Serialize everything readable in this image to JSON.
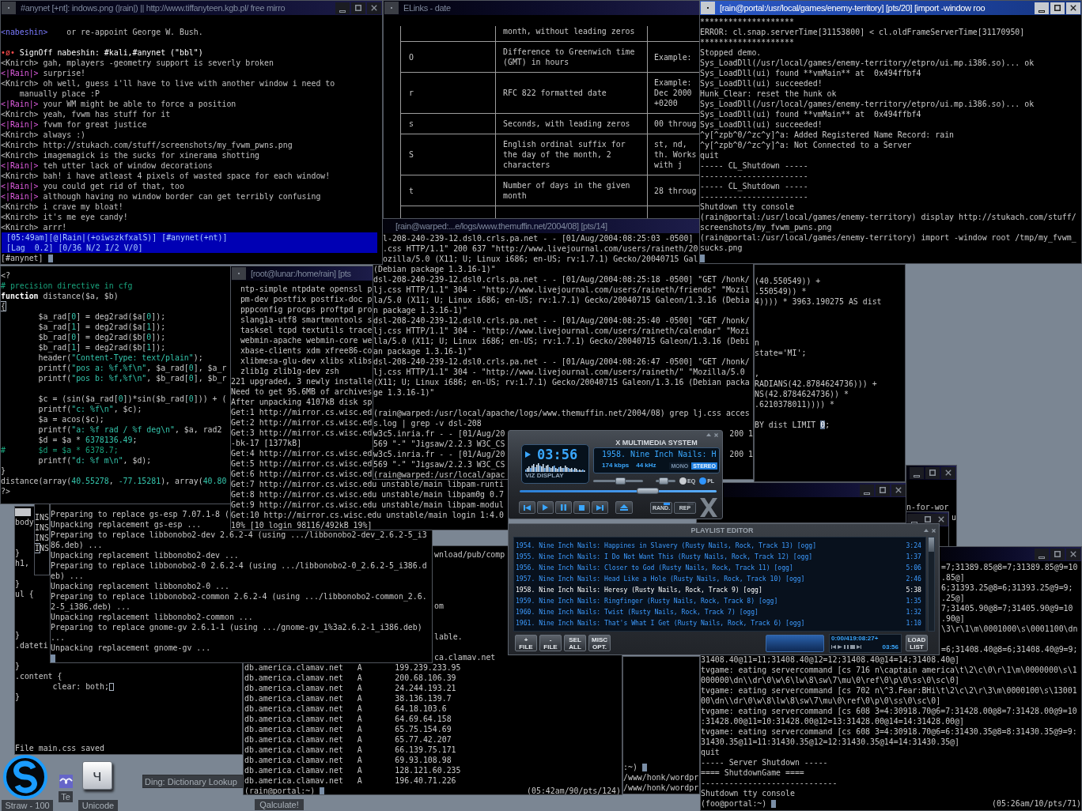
{
  "irc_window": {
    "title": "#anynet [+nt]: indows.png (|rain|) || http://www.tiffanyteen.kgb.pl/ free mirro",
    "active": false,
    "lines": [
      {
        "kind": "msg",
        "nick": "<nabeshin>",
        "color": "#7b7bff",
        "text": "   or re-appoint George W. Bush."
      },
      {
        "kind": "blank"
      },
      {
        "kind": "event",
        "marker": "•ø•",
        "text": "SignOff nabeshin: #kali,#anynet (\"bbl\")"
      },
      {
        "kind": "msg",
        "nick": "<Knirch>",
        "color": "#c0c0c0",
        "text": "gah, mplayers -geometry support is severly broken"
      },
      {
        "kind": "msg",
        "nick": "<|Rain|>",
        "color": "#e35ee3",
        "text": "surprise!"
      },
      {
        "kind": "msg",
        "nick": "<Knirch>",
        "color": "#c0c0c0",
        "text": "oh well, guess i'll have to live with another window i need to"
      },
      {
        "kind": "text",
        "text": "    manually place :P"
      },
      {
        "kind": "msg",
        "nick": "<|Rain|>",
        "color": "#e35ee3",
        "text": "your WM might be able to force a position"
      },
      {
        "kind": "msg",
        "nick": "<Knirch>",
        "color": "#c0c0c0",
        "text": "yeah, fvwm has stuff for it"
      },
      {
        "kind": "msg",
        "nick": "<|Rain|>",
        "color": "#e35ee3",
        "text": "fvwm for great justice"
      },
      {
        "kind": "msg",
        "nick": "<Knirch>",
        "color": "#c0c0c0",
        "text": "always :)"
      },
      {
        "kind": "msg",
        "nick": "<Knirch>",
        "color": "#c0c0c0",
        "text": "http://stukach.com/stuff/screenshots/my_fvwm_pwns.png"
      },
      {
        "kind": "msg",
        "nick": "<Knirch>",
        "color": "#c0c0c0",
        "text": "imagemagick is the sucks for xinerama shotting"
      },
      {
        "kind": "msg",
        "nick": "<|Rain|>",
        "color": "#e35ee3",
        "text": "teh utter lack of window decorations"
      },
      {
        "kind": "msg",
        "nick": "<Knirch>",
        "color": "#c0c0c0",
        "text": "bah! i have atleast 4 pixels of wasted space for each window!"
      },
      {
        "kind": "msg",
        "nick": "<|Rain|>",
        "color": "#e35ee3",
        "text": "you could get rid of that, too"
      },
      {
        "kind": "msg",
        "nick": "<|Rain|>",
        "color": "#e35ee3",
        "text": "although having no window border can get terribly confusing"
      },
      {
        "kind": "msg",
        "nick": "<Knirch>",
        "color": "#c0c0c0",
        "text": "i crave my bloat!"
      },
      {
        "kind": "msg",
        "nick": "<Knirch>",
        "color": "#c0c0c0",
        "text": "it's me eye candy!"
      },
      {
        "kind": "msg",
        "nick": "<Knirch>",
        "color": "#c0c0c0",
        "text": "arrr!"
      }
    ],
    "status_lines": [
      "[05:49am][@|Rain|(+oiwszkfxalS)] [#anynet(+nt)]",
      "[Lag  0.2] [0/36 N/2 I/2 V/0]"
    ],
    "input": {
      "prompt": "[#anynet]"
    }
  },
  "elinks_window": {
    "title": "ELinks - date",
    "active": false,
    "table": {
      "rows": [
        {
          "column_2": "month, without leading zeros"
        },
        {
          "column_1": "O",
          "column_2": "Difference to Greenwich time (GMT) in hours",
          "column_3": "Example:"
        },
        {
          "column_1": "r",
          "column_2": "RFC 822 formatted date",
          "column_3": "Example: Dec 2000 +0200"
        },
        {
          "column_1": "s",
          "column_2": "Seconds, with leading zeros",
          "column_3": "00 throug"
        },
        {
          "column_1": "S",
          "column_2": "English ordinal suffix for the day of the month, 2 characters",
          "column_3": "st, nd, th. Works with j"
        },
        {
          "column_1": "t",
          "column_2": "Number of days in the given month",
          "column_3": "28 throug"
        }
      ]
    }
  },
  "portal_window": {
    "title": "[rain@portal:/usr/local/games/enemy-territory] [pts/20] [import -window roo",
    "active": true,
    "lines": [
      "********************",
      "ERROR: cl.snap.serverTime[31153800] < cl.oldFrameServerTime[31170950]",
      "********************",
      "Stopped demo.",
      "Sys_LoadDll(/usr/local/games/enemy-territory/etpro/ui.mp.i386.so)... ok",
      "Sys_LoadDll(ui) found **vmMain** at  0x494ffbf4",
      "Sys_LoadDll(ui) succeeded!",
      "Hunk_Clear: reset the hunk ok",
      "Sys_LoadDll(/usr/local/games/enemy-territory/etpro/ui.mp.i386.so)... ok",
      "Sys_LoadDll(ui) found **vmMain** at  0x494ffbf4",
      "Sys_LoadDll(ui) succeeded!",
      "^y[^zpb^0/^zc^y]^a: Added Registered Name Record: rain",
      "^y[^zpb^0/^zc^y]^a: Not Connected to a Server",
      "quit",
      "----- CL_Shutdown -----",
      "-----------------------",
      "----- CL_Shutdown -----",
      "-----------------------",
      "Shutdown tty console",
      "(rain@portal:/usr/local/games/enemy-territory) display http://stukach.com/stuff/",
      "screenshots/my_fvwm_pwns.png",
      "(rain@portal:/usr/local/games/enemy-territory) import -window root /tmp/my_fvwm_",
      "sucks.png",
      [
        {
          "kind": "cursor"
        }
      ]
    ]
  },
  "sql_window": {
    "lines": [
      "(40.550549)) +",
      ".550549)) *",
      "4)))) * 3963.190275 AS dist",
      {
        "kind": "blank"
      },
      {
        "kind": "blank"
      },
      {
        "kind": "blank"
      },
      "n",
      "state='MI';",
      {
        "kind": "blank"
      },
      ",",
      "RADIANS(42.8784624736))) +",
      "NS(42.8784624736)) *",
      ".6210378011)))) *",
      {
        "kind": "blank"
      },
      [
        "BY dist LIMIT ",
        {
          "kind": "cursor",
          "text": "0"
        },
        ";"
      ]
    ]
  },
  "php_editor": {
    "lines": [
      "<?",
      [
        {
          "kind": "comment",
          "text": "# precision directive in cfg"
        }
      ],
      [
        {
          "kind": "keyword",
          "text": "function"
        },
        " distance($a, $b)"
      ],
      [
        {
          "kind": "cursor",
          "text": "{"
        }
      ],
      [
        "        $a_rad[",
        {
          "kind": "number",
          "text": "0"
        },
        "] = deg2rad($a[",
        {
          "kind": "number",
          "text": "0"
        },
        "]);"
      ],
      [
        "        $a_rad[",
        {
          "kind": "number",
          "text": "1"
        },
        "] = deg2rad($a[",
        {
          "kind": "number",
          "text": "1"
        },
        "]);"
      ],
      [
        "        $b_rad[",
        {
          "kind": "number",
          "text": "0"
        },
        "] = deg2rad($b[",
        {
          "kind": "number",
          "text": "0"
        },
        "]);"
      ],
      [
        "        $b_rad[",
        {
          "kind": "number",
          "text": "1"
        },
        "] = deg2rad($b[",
        {
          "kind": "number",
          "text": "1"
        },
        "]);"
      ],
      [
        "        header(",
        {
          "kind": "string",
          "text": "\"Content-Type: text/plain\""
        },
        ");"
      ],
      [
        "        printf(",
        {
          "kind": "string",
          "text": "\"pos a: %f,%f\\n\""
        },
        ", $a_rad[",
        {
          "kind": "number",
          "text": "0"
        },
        "], $a_r"
      ],
      [
        "        printf(",
        {
          "kind": "string",
          "text": "\"pos b: %f,%f\\n\""
        },
        ", $b_rad[",
        {
          "kind": "number",
          "text": "0"
        },
        "], $b_r"
      ],
      {
        "kind": "blank"
      },
      [
        "        $c = (sin($a_rad[",
        {
          "kind": "number",
          "text": "0"
        },
        "])*sin($b_rad[",
        {
          "kind": "number",
          "text": "0"
        },
        "])) + ("
      ],
      [
        "        printf(",
        {
          "kind": "string",
          "text": "\"c: %f\\n\""
        },
        ", $c);"
      ],
      "        $a = acos($c);",
      [
        "        printf(",
        {
          "kind": "string",
          "text": "\"a: %f rad / %f deg\\n\""
        },
        ", $a, rad2"
      ],
      [
        "        $d = $a * ",
        {
          "kind": "number",
          "text": "6378136.49"
        },
        ";"
      ],
      [
        {
          "kind": "comment",
          "text": "#       $d = $a * 6378.7;"
        }
      ],
      [
        "        printf(",
        {
          "kind": "string",
          "text": "\"d: %f m\\n\""
        },
        ", $d);"
      ],
      "}",
      [
        "distance(array(",
        {
          "kind": "number",
          "text": "40.55278"
        },
        ", ",
        {
          "kind": "number",
          "text": "-77.15281"
        },
        "), array(",
        {
          "kind": "number",
          "text": "40.80"
        }
      ],
      "?>"
    ]
  },
  "lunar_window": {
    "title": "[root@lunar:/home/rain] [pts",
    "active": false,
    "lines": [
      "  ntp-simple ntpdate openssl p",
      "  pm-dev postfix postfix-doc p",
      "  pppconfig procps proftpd pro",
      "  slang1a-utf8 smartmontools s",
      "  tasksel tcpd textutils trace",
      "  webmin-apache webmin-core we",
      "  xbase-clients xdm xfree86-co",
      "  xlibmesa-glu-dev xlibs xlibs",
      "  zlib1g zlib1g-dev zsh",
      "221 upgraded, 3 newly installe",
      "Need to get 95.6MB of archives",
      "After unpacking 4107kB disk sp",
      "Get:1 http://mirror.cs.wisc.ed",
      "Get:2 http://mirror.cs.wisc.ed",
      "Get:3 http://mirror.cs.wisc.ed",
      "-bk-17 [1377kB]",
      "Get:4 http://mirror.cs.wisc.ed",
      "Get:5 http://mirror.cs.wisc.ed",
      "Get:6 http://mirror.cs.wisc.ed",
      "Get:7 http://mirror.cs.wisc.edu unstable/main libpam-runti",
      "Get:8 http://mirror.cs.wisc.edu unstable/main libpam0g 0.7",
      "Get:9 http://mirror.cs.wisc.edu unstable/main libpam-modul",
      "Get:10 http://mirror.cs.wisc.edu unstable/main login 1:4.0",
      "10% [10 login 98116/492kB 19%]"
    ]
  },
  "warped_window": {
    "title": "[rain@warped:...e/logs/www.themuffin.net/2004/08] [pts/14]",
    "active": false,
    "lines": [
      {
        "kind": "tail",
        "text": "l-208-240-239-12.dsl0.crls.pa.net - - [01/Aug/2004:08:25:03 -0500]"
      },
      {
        "kind": "tail",
        "text": ".css HTTP/1.1\" 200 637 \"http://www.livejournal.com/users/raineth/20"
      },
      {
        "kind": "tail",
        "text": "ozilla/5.0 (X11; U; Linux i686; en-US; rv:1.7.1) Gecko/20040715 Gal"
      },
      "(Debian package 1.3.16-1)\"",
      "dsl-208-240-239-12.dsl0.crls.pa.net - - [01/Aug/2004:08:25:18 -0500] \"GET /honk/",
      "lj.css HTTP/1.1\" 304 - \"http://www.livejournal.com/users/raineth/friends\" \"Mozil",
      "la/5.0 (X11; U; Linux i686; en-US; rv:1.7.1) Gecko/20040715 Galeon/1.3.16 (Debia",
      "n package 1.3.16-1)\"",
      "dsl-208-240-239-12.dsl0.crls.pa.net - - [01/Aug/2004:08:25:40 -0500] \"GET /honk/",
      "lj.css HTTP/1.1\" 304 - \"http://www.livejournal.com/users/raineth/calendar\" \"Mozi",
      "lla/5.0 (X11; U; Linux i686; en-US; rv:1.7.1) Gecko/20040715 Galeon/1.3.16 (Debi",
      "an package 1.3.16-1)\"",
      "dsl-208-240-239-12.dsl0.crls.pa.net - - [01/Aug/2004:08:26:47 -0500] \"GET /honk/",
      "lj.css HTTP/1.1\" 304 - \"http://www.livejournal.com/users/raineth/\" \"Mozilla/5.0 ",
      "(X11; U; Linux i686; en-US; rv:1.7.1) Gecko/20040715 Galeon/1.3.16 (Debian packa",
      "ge 1.3.16-1)\"",
      {
        "kind": "blank"
      },
      "(rain@warped:/usr/local/apache/logs/www.themuffin.net/2004/08) grep lj.css acces",
      "s.log | grep -v dsl-208",
      [
        "w3c5.inria.fr - - [01/Aug/20",
        {
          "kind": "right",
          "text": "200 1"
        }
      ],
      "569 \"-\" \"Jigsaw/2.2.3 W3C_CS",
      [
        "w3c5.inria.fr - - [01/Aug/20",
        {
          "kind": "right",
          "text": "200 1"
        }
      ],
      "569 \"-\" \"Jigsaw/2.2.3 W3C_CS",
      "(rain@warped:/usr/local/apac"
    ]
  },
  "mid_window": {
    "active": false
  },
  "green_window": {
    "active": false,
    "lines": [
      {
        "kind": "blank"
      },
      {
        "kind": "blank"
      },
      "n-for-wor",
      [
        {
          "kind": "right",
          "text": "u"
        }
      ]
    ]
  },
  "small_window": {
    "active": false
  },
  "css_editor": {
    "lines": [
      {
        "kind": "mark"
      },
      "body",
      {
        "kind": "blank"
      },
      {
        "kind": "blank"
      },
      "}",
      "h1,",
      {
        "kind": "blank"
      },
      "}",
      "ul {",
      {
        "kind": "blank"
      },
      {
        "kind": "blank"
      },
      {
        "kind": "blank"
      },
      "}",
      ".dateti",
      {
        "kind": "blank"
      },
      "}",
      ".content {",
      [
        "        clear: both;",
        {
          "kind": "cursor"
        }
      ],
      "}",
      {
        "kind": "blank"
      },
      {
        "kind": "blank"
      },
      {
        "kind": "blank"
      },
      {
        "kind": "blank"
      },
      "File main.css saved"
    ]
  },
  "insert_column": {
    "lines": [
      "INS",
      "INS",
      "INS",
      [
        {
          "kind": "cursor",
          "text": "I"
        },
        "NS"
      ]
    ]
  },
  "dpkg_window": {
    "lines": [
      "Preparing to replace gs-esp 7.07.1-8 (",
      "Unpacking replacement gs-esp ...",
      "Preparing to replace libbonobo2-dev 2.6.2-4 (using .../libbonobo2-dev_2.6.2-5_i3",
      "86.deb) ...",
      "Unpacking replacement libbonobo2-dev ...",
      "Preparing to replace libbonobo2-0 2.6.2-4 (using .../libbonobo2-0_2.6.2-5_i386.d",
      "eb) ...",
      "Unpacking replacement libbonobo2-0 ...",
      "Preparing to replace libbonobo2-common 2.6.2-4 (using .../libbonobo2-common_2.6.",
      "2-5_i386.deb) ...",
      "Unpacking replacement libbonobo2-common ...",
      "Preparing to replace gnome-gv 2.6.1-1 (using .../gnome-gv_1%3a2.6.2-1_i386.deb)",
      "...",
      "Unpacking replacement gnome-gv ...",
      [
        {
          "kind": "cursor"
        }
      ]
    ]
  },
  "clamav_window": {
    "lines": [
      {
        "kind": "tail",
        "text": "wnload/pub/comp"
      },
      {
        "kind": "blank"
      },
      {
        "kind": "blank"
      },
      {
        "kind": "blank"
      },
      {
        "kind": "blank"
      },
      {
        "kind": "tail",
        "text": "om"
      },
      {
        "kind": "blank"
      },
      {
        "kind": "blank"
      },
      {
        "kind": "tail",
        "text": "lable."
      },
      {
        "kind": "blank"
      },
      {
        "kind": "tail",
        "text": "ca.clamav.net"
      },
      "db.america.clamav.net   A       199.239.233.95",
      "db.america.clamav.net   A       200.68.106.39",
      "db.america.clamav.net   A       24.244.193.21",
      "db.america.clamav.net   A       38.136.139.7",
      "db.america.clamav.net   A       64.18.103.6",
      "db.america.clamav.net   A       64.69.64.158",
      "db.america.clamav.net   A       65.75.154.69",
      "db.america.clamav.net   A       65.77.42.207",
      "db.america.clamav.net   A       66.139.75.171",
      "db.america.clamav.net   A       69.93.108.98",
      "db.america.clamav.net   A       128.121.60.235",
      "db.america.clamav.net   A       196.40.71.226",
      [
        "(rain@portal:~) ",
        {
          "kind": "cursor"
        },
        {
          "kind": "right",
          "text": "(05:42am/90/pts/124)"
        }
      ]
    ]
  },
  "honk_window": {
    "lines": [
      [
        ":~) ",
        {
          "kind": "cursor"
        }
      ],
      "/www/honk/wordpr",
      "/www/honk/wordpr"
    ]
  },
  "tvgame_window": {
    "active": false,
    "lines": [
      {
        "kind": "tail",
        "text": "=7;31389.85@8=7;31389.85@9=10"
      },
      {
        "kind": "tail",
        "text": ".85@]"
      },
      {
        "kind": "tail",
        "text": "6;31393.25@8=6;31393.25@9=9;"
      },
      {
        "kind": "tail",
        "text": ".25@]"
      },
      {
        "kind": "tail",
        "text": "7;31405.90@8=7;31405.90@9=10"
      },
      {
        "kind": "tail",
        "text": ".90@]"
      },
      {
        "kind": "tail",
        "text": "\\3\\r\\1\\m\\0001000\\s\\0001100\\dn"
      },
      {
        "kind": "blank"
      },
      {
        "kind": "tail",
        "text": "=6;31408.40@8=6;31408.40@9=9;"
      },
      "31408.40@11=11;31408.40@12=12;31408.40@14=14;31408.40@]",
      "tvgame: eating servercommand [cs 716 n\\captain america\\t\\2\\c\\0\\r\\1\\m\\0000000\\s\\1",
      "000000\\dn\\\\dr\\0\\w\\6\\lw\\8\\sw\\7\\mu\\0\\ref\\0\\p\\0\\ss\\0\\sc\\0]",
      "tvgame: eating servercommand [cs 702 n\\^3.Fear:BHi\\t\\2\\c\\2\\r\\3\\m\\0000100\\s\\13001",
      "00\\dn\\\\dr\\0\\w\\8\\lw\\8\\sw\\7\\mu\\0\\ref\\0\\p\\0\\ss\\0\\sc\\0]",
      "tvgame: eating servercommand [cs 608 3=4:30918.70@6=7:31428.00@8=7:31428.00@9=10",
      ":31428.00@11=10:31428.00@12=13:31428.00@14=14:31428.00@]",
      "tvgame: eating servercommand [cs 608 3=4:30918.70@6=6:31430.35@8=8:31430.35@9=9:",
      "31430.35@11=11:31430.35@12=12:31430.35@14=14:31430.35@]",
      "quit",
      "----- Server Shutdown -----",
      "==== ShutdownGame ====",
      "-----------------------------",
      "Shutdown tty console",
      [
        "(foo@portal:~) ",
        {
          "kind": "cursor"
        },
        {
          "kind": "right",
          "text": "(05:26am/10/pts/71)"
        }
      ]
    ]
  },
  "xmms_player": {
    "title": "X MULTIMEDIA SYSTEM",
    "playing": true,
    "time": "03:56",
    "vis_label": "VIZ DISPLAY",
    "song": "1958. Nine Inch Nails: H",
    "bitrate": "174 kbps",
    "samplerate": "44 kHz",
    "channels": [
      {
        "label": "MONO",
        "on": false
      },
      {
        "label": "STEREO",
        "on": true
      }
    ],
    "volume": {
      "level": 0.56
    },
    "balance": {
      "level": 0.3
    },
    "toggles": [
      {
        "label": "EQ",
        "on": false
      },
      {
        "label": "PL",
        "on": true
      }
    ],
    "seek": {
      "level": 0.67
    },
    "shuffle": {
      "label": "RAND.",
      "on": true
    },
    "repeat": {
      "label": "REP",
      "on": false
    }
  },
  "playlist_editor": {
    "title": "PLAYLIST EDITOR",
    "tracks": [
      {
        "title": "1954. Nine Inch Nails: Happines in Slavery (Rusty Nails, Rock, Track 13) [ogg]",
        "duration": "3:24",
        "playing": false
      },
      {
        "title": "1955. Nine Inch Nails: I Do Not Want This (Rusty Nails, Rock, Track 12) [ogg]",
        "duration": "1:37",
        "playing": false
      },
      {
        "title": "1956. Nine Inch Nails: Closer to God (Rusty Nails, Rock, Track 11) [ogg]",
        "duration": "5:06",
        "playing": false
      },
      {
        "title": "1957. Nine Inch Nails: Head Like a Hole (Rusty Nails, Rock, Track 10) [ogg]",
        "duration": "2:46",
        "playing": false
      },
      {
        "title": "1958. Nine Inch Nails: Heresy (Rusty Nails, Rock, Track 9) [ogg]",
        "duration": "5:38",
        "playing": true
      },
      {
        "title": "1959. Nine Inch Nails: Ringfinger (Rusty Nails, Rock, Track 8) [ogg]",
        "duration": "1:35",
        "playing": false
      },
      {
        "title": "1960. Nine Inch Nails: Twist (Rusty Nails, Rock, Track 7) [ogg]",
        "duration": "1:32",
        "playing": false
      },
      {
        "title": "1961. Nine Inch Nails: That's What I Get (Rusty Nails, Rock, Track 6) [ogg]",
        "duration": "1:10",
        "playing": false
      }
    ],
    "buttons": [
      "+ FILE",
      "- FILE",
      "SEL ALL",
      "MISC OPT."
    ],
    "time_display": "0:00/419:08:27+",
    "elapsed": "03:56",
    "load_button": "LOAD LIST"
  },
  "dock": {
    "items": [
      {
        "kind": "logo",
        "label": "Straw - 100"
      },
      {
        "kind": "bird",
        "label": "Te"
      },
      {
        "kind": "key",
        "glyph": "ч",
        "label": "Unicode"
      },
      {
        "kind": "field",
        "placeholder": "Ding: Dictionary Lookup"
      },
      {
        "kind": "label",
        "label": "Qalculate!"
      }
    ]
  }
}
